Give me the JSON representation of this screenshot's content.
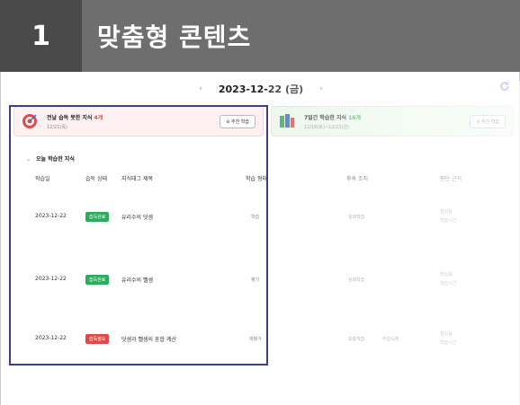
{
  "header": {
    "number": "1",
    "title": "맞춤형 콘텐츠"
  },
  "datebar": {
    "prev": "‹",
    "date": "2023-12-22 (금)",
    "next": "›",
    "refresh_icon": "refresh-icon"
  },
  "cards": {
    "left": {
      "title_prefix": "전날 습득 못한 지식 ",
      "title_count": "4개",
      "subtitle": "12/21(목)",
      "button": "추천 학습"
    },
    "right": {
      "title_prefix": "7일간 학습한 지식 ",
      "title_count": "16개",
      "subtitle": "12/16(토)~12/22(금)",
      "button": "추천 학습"
    }
  },
  "section": {
    "chevron": "⌄",
    "title": "오늘 학습한 지식"
  },
  "table": {
    "headers": [
      "학습일",
      "습득 상태",
      "지식태그 제목",
      "학습 형태",
      "후속 조치",
      "판단 근거"
    ],
    "rows": [
      {
        "date": "2023-12-22",
        "status": "습득완료",
        "title": "유리수의 덧셈",
        "type": "학습",
        "followup": "심화학습",
        "followup2": "",
        "reason1": "정답률",
        "reason2": "학습시간"
      },
      {
        "date": "2023-12-22",
        "status": "습득완료",
        "title": "유리수의 뺄셈",
        "type": "평가",
        "followup": "심화학습",
        "followup2": "",
        "reason1": "정답률",
        "reason2": "학습시간"
      },
      {
        "date": "2023-12-22",
        "status": "습득필요",
        "title": "덧셈과 뺄셈의 혼합 계산",
        "type": "재평가",
        "followup": "보충학습",
        "followup2": "추합속제",
        "reason1": "정답률",
        "reason2": "학습시간"
      }
    ]
  },
  "colors": {
    "accent_blue": "#3b6bd8",
    "badge_green": "#2fab5e",
    "badge_red": "#e24a4a",
    "highlight": "#3b3f8c"
  }
}
